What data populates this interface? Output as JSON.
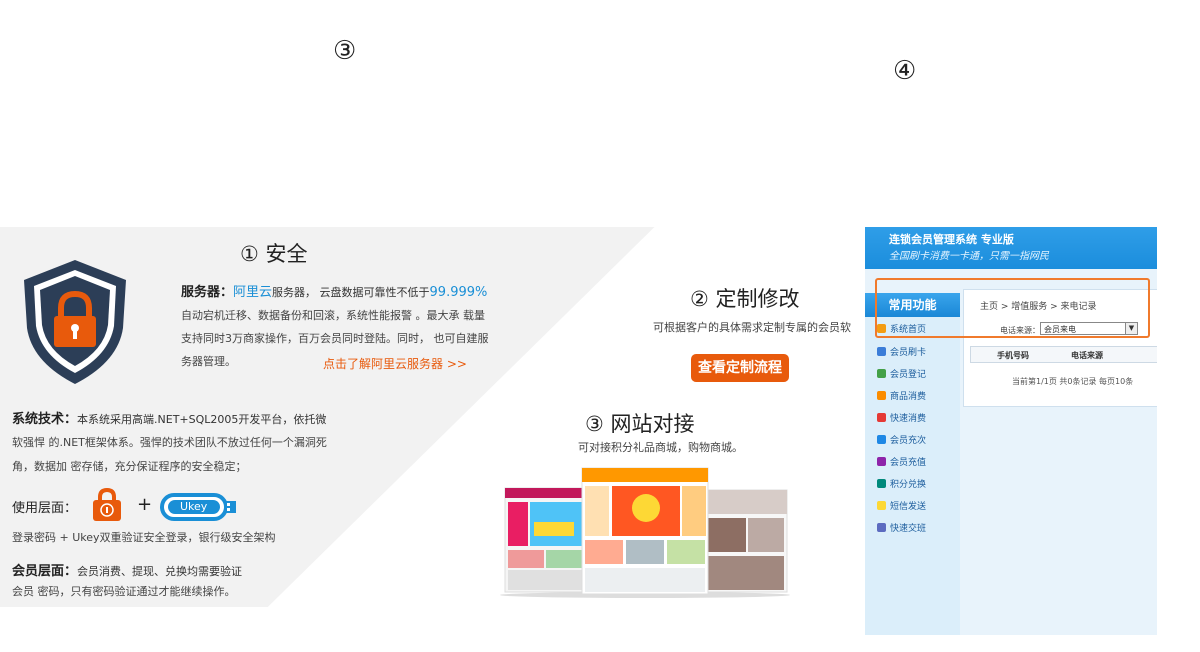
{
  "markers": {
    "top_left": "③",
    "top_right": "④"
  },
  "security": {
    "title": "① 安全",
    "server_label": "服务器：",
    "server_name": "阿里云",
    "server_text": "服务器，  云盘数据可靠性不低于",
    "server_rate": "99.999%",
    "server_lines": [
      "自动宕机迁移、数据备份和回滚，系统性能报警 。最大承 载量",
      "支持同时3万商家操作，百万会员同时登陆。同时，  也可自建服",
      "务器管理。"
    ],
    "server_link": "点击了解阿里云服务器 >>",
    "tech_label": "系统技术：",
    "tech_lines": [
      "本系统采用高端.NET+SQL2005开发平台，依托微",
      "软强悍 的.NET框架体系。强悍的技术团队不放过任何一个漏洞死",
      "角，数据加 密存储，充分保证程序的安全稳定；"
    ],
    "use_label": "使用层面：",
    "plus": "+",
    "ukey": "Ukey",
    "use_text": "登录密码 + Ukey双重验证安全登录，银行级安全架构",
    "member_label": "会员层面：",
    "member_lines": [
      "会员消费、提现、兑换均需要验证",
      "会员 密码，只有密码验证通过才能继续操作。"
    ]
  },
  "custom": {
    "title": "② 定制修改",
    "desc": "可根据客户的具体需求定制专属的会员软",
    "button": "查看定制流程"
  },
  "website": {
    "title": "③ 网站对接",
    "desc": "可对接积分礼品商城，购物商城。"
  },
  "app": {
    "title": "连锁会员管理系统 专业版",
    "slogan": "全国刷卡消费一卡通，只需一指网民",
    "sidebar_head": "常用功能",
    "sidebar_items": [
      "系统首页",
      "会员刷卡",
      "会员登记",
      "商品消费",
      "快速消费",
      "会员充次",
      "会员充值",
      "积分兑换",
      "短信发送",
      "快速交班"
    ],
    "breadcrumb": "主页  >  增值服务  >  来电记录",
    "filter_label": "电话来源：",
    "filter_value": "会员来电",
    "columns": [
      "手机号码",
      "电话来源"
    ],
    "pager": "当前第1/1页 共0条记录 每页10条"
  },
  "colors": {
    "accent_orange": "#e85a0c",
    "brand_blue": "#1a8fd6",
    "shield_dark": "#2c3e57",
    "highlight": "#f07a2c"
  }
}
